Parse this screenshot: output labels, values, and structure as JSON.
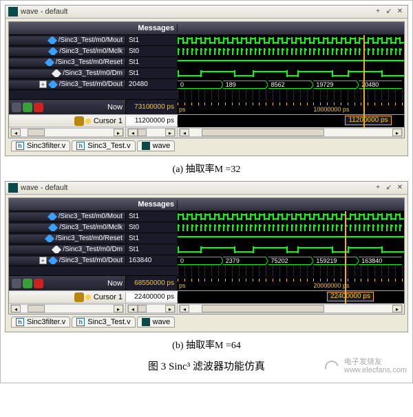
{
  "windows": [
    {
      "title": "wave - default",
      "messages_header": "Messages",
      "signals": [
        {
          "name": "/Sinc3_Test/m0/Mout",
          "msg": "St1",
          "icon": "blue",
          "expand": false
        },
        {
          "name": "/Sinc3_Test/m0/Mclk",
          "msg": "St0",
          "icon": "blue",
          "expand": false
        },
        {
          "name": "/Sinc3_Test/m0/Reset",
          "msg": "St1",
          "icon": "blue",
          "expand": false
        },
        {
          "name": "/Sinc3_Test/m0/Dm",
          "msg": "St1",
          "icon": "white",
          "expand": false
        },
        {
          "name": "/Sinc3_Test/m0/Dout",
          "msg": "20480",
          "icon": "blue",
          "expand": true
        }
      ],
      "bus_values": [
        "0",
        "189",
        "8562",
        "19729",
        "20480"
      ],
      "now_label": "Now",
      "now_value": "73100000 ps",
      "time_marker": "10000000 ps",
      "time_ps": "ps",
      "cursor_label": "Cursor 1",
      "cursor_value": "11200000 ps",
      "cursor_badge": "11200000 ps",
      "cursor_x_pct": 82,
      "tabs": [
        {
          "kind": "file",
          "label": "Sinc3filter.v"
        },
        {
          "kind": "file",
          "label": "Sinc3_Test.v"
        },
        {
          "kind": "wave",
          "label": "wave"
        }
      ],
      "caption": "(a) 抽取率M =32"
    },
    {
      "title": "wave - default",
      "messages_header": "Messages",
      "signals": [
        {
          "name": "/Sinc3_Test/m0/Mout",
          "msg": "St1",
          "icon": "blue",
          "expand": false
        },
        {
          "name": "/Sinc3_Test/m0/Mclk",
          "msg": "St0",
          "icon": "blue",
          "expand": false
        },
        {
          "name": "/Sinc3_Test/m0/Reset",
          "msg": "St1",
          "icon": "blue",
          "expand": false
        },
        {
          "name": "/Sinc3_Test/m0/Dm",
          "msg": "St1",
          "icon": "white",
          "expand": false
        },
        {
          "name": "/Sinc3_Test/m0/Dout",
          "msg": "163840",
          "icon": "blue",
          "expand": true
        }
      ],
      "bus_values": [
        "0",
        "2379",
        "75202",
        "159219",
        "163840"
      ],
      "now_label": "Now",
      "now_value": "68550000 ps",
      "time_marker": "20000000 ps",
      "time_ps": "ps",
      "cursor_label": "Cursor 1",
      "cursor_value": "22400000 ps",
      "cursor_badge": "22400000 ps",
      "cursor_x_pct": 74,
      "tabs": [
        {
          "kind": "file",
          "label": "Sinc3filter.v"
        },
        {
          "kind": "file",
          "label": "Sinc3_Test.v"
        },
        {
          "kind": "wave",
          "label": "wave"
        }
      ],
      "caption": "(b) 抽取率M =64"
    }
  ],
  "figure_caption": "图 3 Sinc³ 滤波器功能仿真",
  "watermark_text": "电子发烧友\nwww.elecfans.com"
}
